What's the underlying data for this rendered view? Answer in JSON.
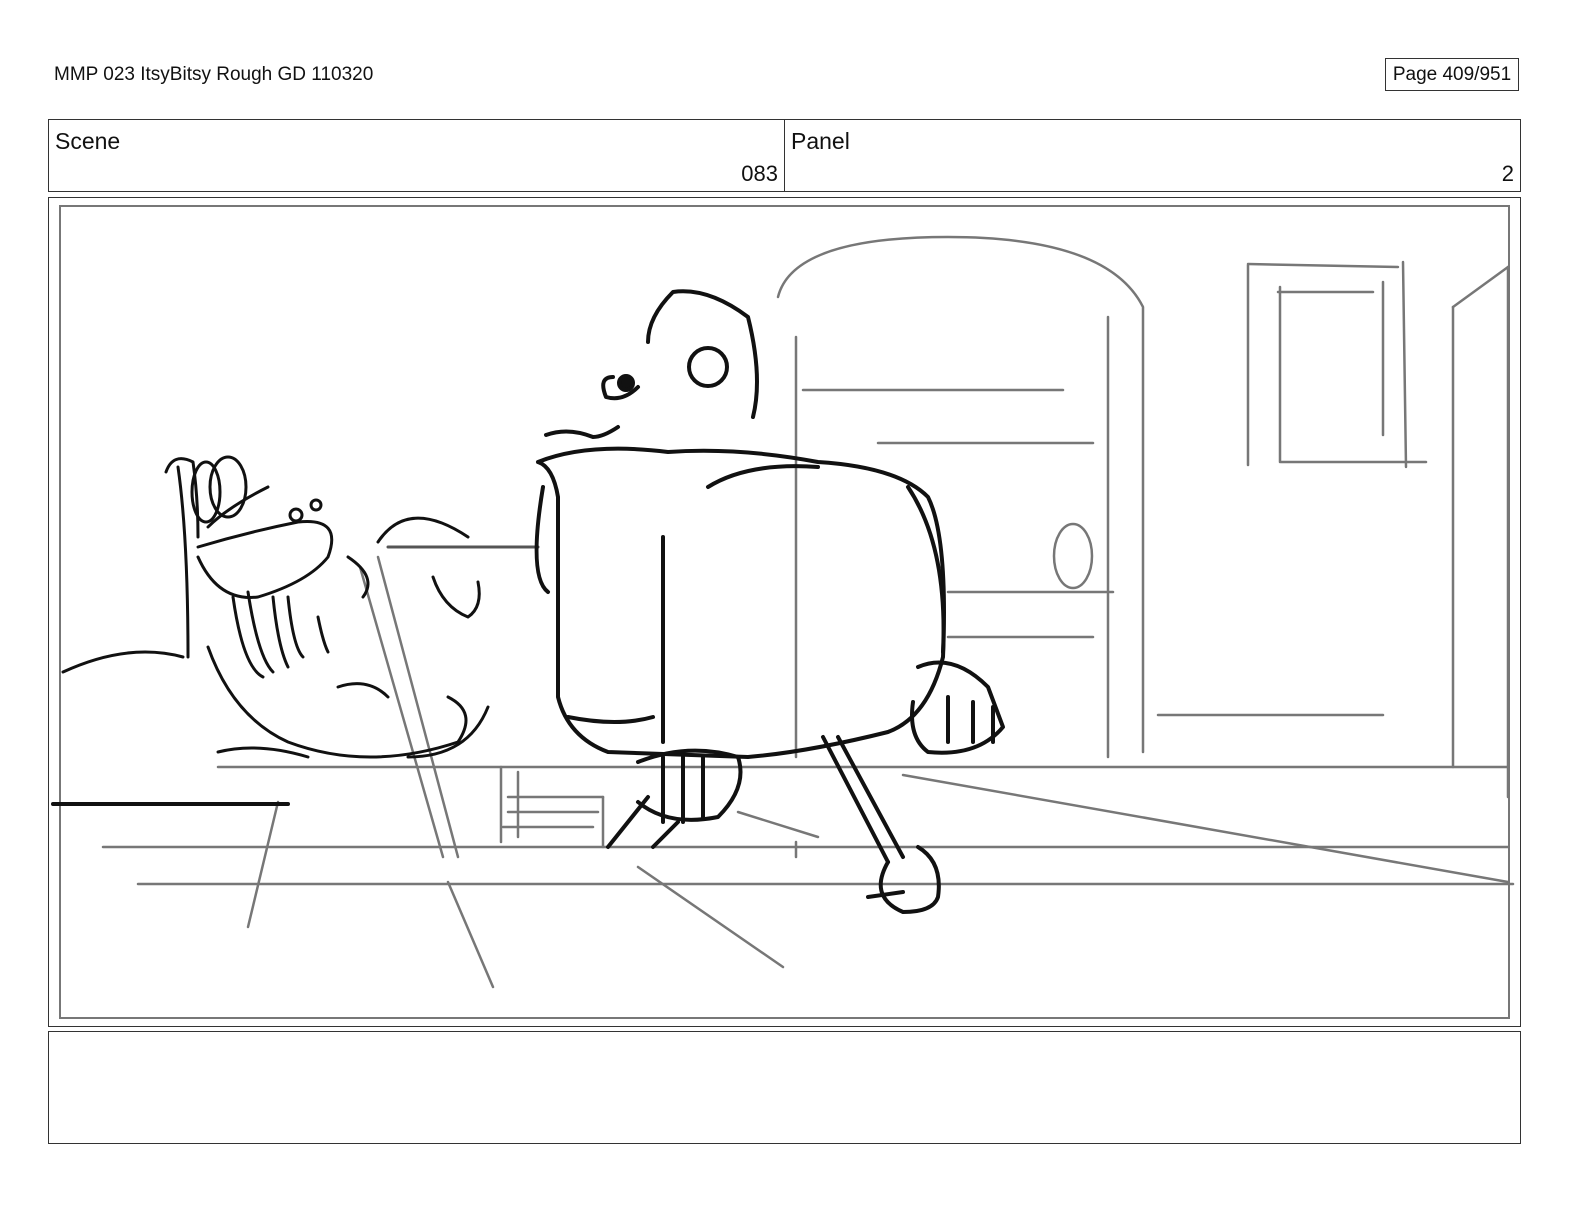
{
  "document": {
    "title": "MMP 023 ItsyBitsy Rough GD 110320",
    "page_label": "Page 409/951"
  },
  "header": {
    "scene_label": "Scene",
    "scene_value": "083",
    "panel_label": "Panel",
    "panel_value": "2"
  },
  "notes": {
    "text": ""
  },
  "colors": {
    "ink": "#111111",
    "sketch_gray": "#777777",
    "border": "#333333"
  }
}
